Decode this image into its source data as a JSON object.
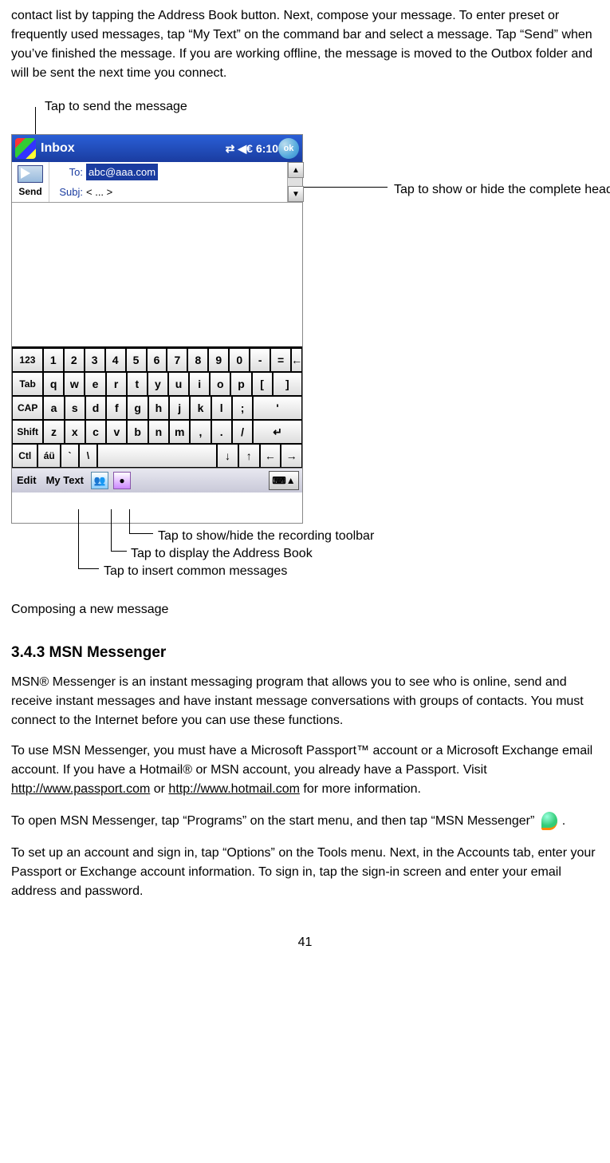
{
  "intro": "contact list by tapping the Address Book button. Next, compose your message. To enter preset or frequently used messages, tap “My Text” on the command bar and select a message. Tap “Send” when you’ve finished the message. If you are working offline, the message is moved to the Outbox folder and will be sent the next time you connect.",
  "callouts": {
    "send": "Tap to send the message",
    "header_toggle": "Tap to show or hide the complete header",
    "recording": "Tap to show/hide the recording toolbar",
    "address_book": "Tap to display the Address Book",
    "my_text": "Tap to insert common messages"
  },
  "device": {
    "titlebar": {
      "title": "Inbox",
      "time": "6:10",
      "ok": "ok"
    },
    "send_label": "Send",
    "to": {
      "label": "To:",
      "value": "abc@aaa.com"
    },
    "subj": {
      "label": "Subj:",
      "value": "< ... >"
    },
    "keyboard": {
      "r1": [
        "123",
        "1",
        "2",
        "3",
        "4",
        "5",
        "6",
        "7",
        "8",
        "9",
        "0",
        "-",
        "=",
        "←"
      ],
      "r2": [
        "Tab",
        "q",
        "w",
        "e",
        "r",
        "t",
        "y",
        "u",
        "i",
        "o",
        "p",
        "[",
        "]"
      ],
      "r3": [
        "CAP",
        "a",
        "s",
        "d",
        "f",
        "g",
        "h",
        "j",
        "k",
        "l",
        ";",
        "'"
      ],
      "r4": [
        "Shift",
        "z",
        "x",
        "c",
        "v",
        "b",
        "n",
        "m",
        ",",
        ".",
        "/",
        "↵"
      ],
      "r5": [
        "Ctl",
        "áü",
        "`",
        "\\"
      ]
    },
    "bottombar": {
      "edit": "Edit",
      "mytext": "My Text",
      "kbd": "⌨▲"
    }
  },
  "figure_caption": "Composing a new message",
  "section": {
    "heading": "3.4.3 MSN Messenger",
    "p1": "MSN® Messenger is an instant messaging program that allows you to see who is online, send and receive instant messages and have instant message conversations with groups of contacts. You must connect to the Internet before you can use these functions.",
    "p2a": "To use MSN Messenger, you must have a Microsoft Passport™ account or a Microsoft Exchange email account. If you have a Hotmail® or MSN account, you already have a Passport. Visit ",
    "link1": "http://www.passport.com",
    "p2b": " or ",
    "link2": "http://www.hotmail.com",
    "p2c": " for more information.",
    "p3a": "To open MSN Messenger, tap “Programs” on the start menu, and then tap “MSN Messenger” ",
    "p3b": ".",
    "p4": "To set up an account and sign in, tap “Options” on the Tools menu. Next, in the Accounts tab, enter your Passport or Exchange account information. To sign in, tap the sign-in screen and enter your email address and password."
  },
  "page_number": "41"
}
